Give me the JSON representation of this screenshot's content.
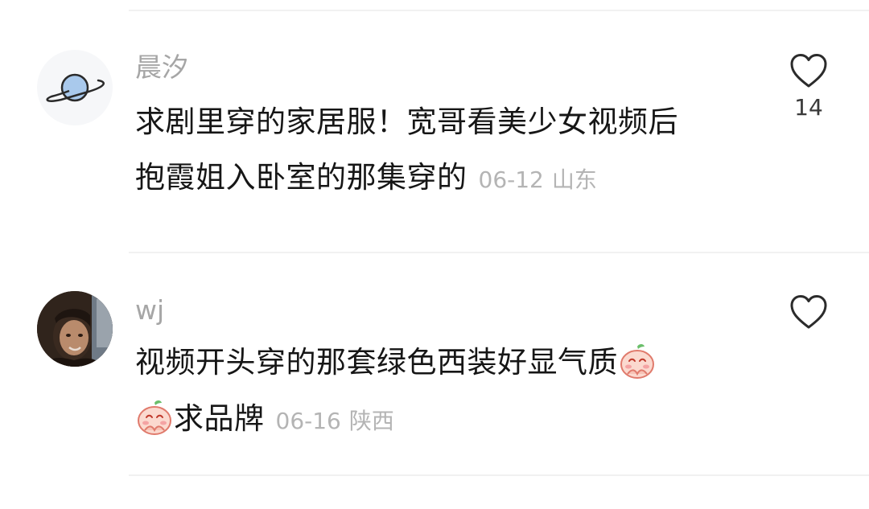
{
  "comments": [
    {
      "username": "晨汐",
      "text_line1": "求剧里穿的家居服！宽哥看美少女视频后",
      "text_line2": "抱霞姐入卧室的那集穿的",
      "date": "06-12",
      "location": "山东",
      "likes": "14",
      "avatar_icon": "planet-icon"
    },
    {
      "username": "wj",
      "text_line1": "视频开头穿的那套绿色西装好显气质",
      "text_line2": "求品牌",
      "date": "06-16",
      "location": "陕西",
      "likes": "",
      "avatar_icon": "photo"
    }
  ],
  "colors": {
    "username": "#a6a6a6",
    "text": "#161616",
    "meta": "#b4b4b4",
    "divider": "#f1f1f1"
  }
}
